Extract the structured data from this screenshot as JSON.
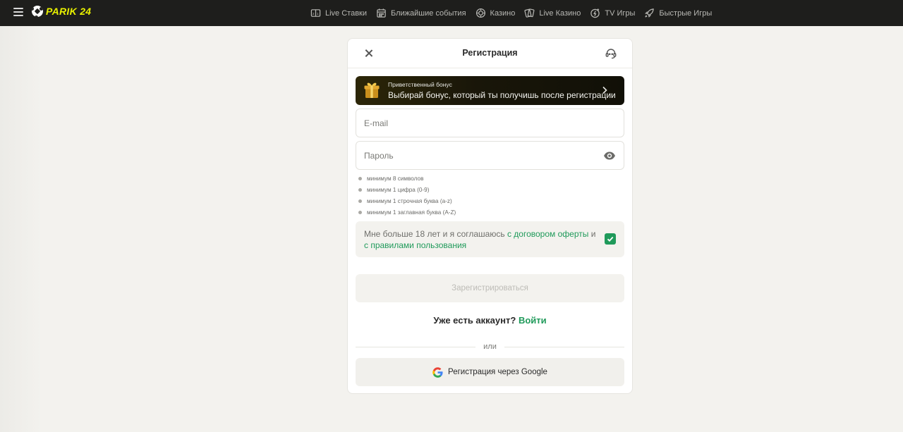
{
  "topbar": {
    "logo_text": "PARIK 24",
    "nav": [
      {
        "label": "Live Ставки",
        "icon": "scoreboard-icon"
      },
      {
        "label": "Ближайшие события",
        "icon": "calendar-icon"
      },
      {
        "label": "Казино",
        "icon": "casino-chip-icon"
      },
      {
        "label": "Live Казино",
        "icon": "cards-icon"
      },
      {
        "label": "TV Игры",
        "icon": "tv-games-icon"
      },
      {
        "label": "Быстрые Игры",
        "icon": "rocket-icon"
      }
    ],
    "accent_color": "#e8f000"
  },
  "modal": {
    "title": "Регистрация",
    "bonus": {
      "small": "Приветственный бонус",
      "main": "Выбирай бонус, который ты получишь после регистрации"
    },
    "email_placeholder": "E-mail",
    "password_placeholder": "Пароль",
    "rules": [
      "минимум 8 символов",
      "минимум 1 цифра (0-9)",
      "минимум 1 строчная буква (a-z)",
      "минимум 1 заглавная буква (A-Z)"
    ],
    "agree": {
      "text_before": "Мне больше 18 лет и я соглашаюсь ",
      "link_offer": "с договором оферты",
      "text_middle": " и ",
      "link_rules": "с правилами пользования",
      "checked": true
    },
    "register_label": "Зарегистрироваться",
    "has_account": "Уже есть аккаунт?",
    "login_link": "Войти",
    "or_label": "или",
    "google_label": "Регистрация через Google",
    "green_color": "#1f9a5a"
  }
}
